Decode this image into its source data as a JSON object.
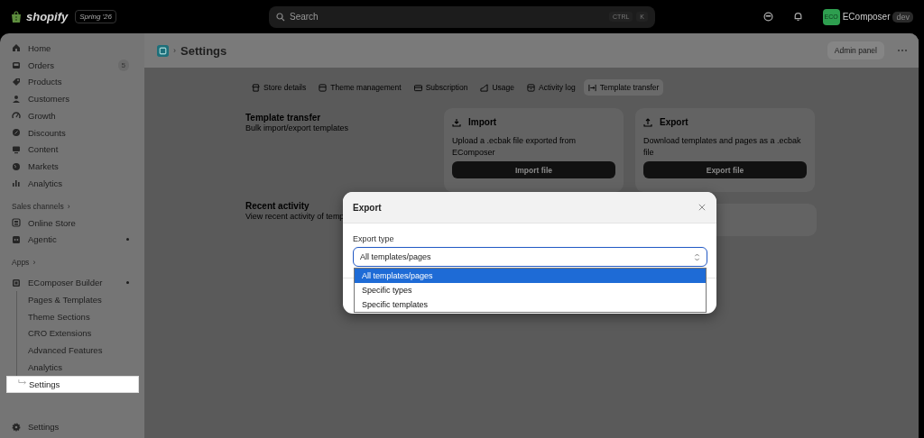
{
  "topbar": {
    "logo": "shopify",
    "version": "Spring '26",
    "search": {
      "placeholder": "Search"
    },
    "shortcut": [
      "CTRL",
      "K"
    ],
    "store": {
      "avatar": "ECO",
      "name": "EComposer",
      "tag": "dev"
    }
  },
  "sidebar": {
    "items": [
      {
        "kind": "item",
        "label": "Home",
        "selected": false
      },
      {
        "kind": "item",
        "label": "Orders",
        "badge": "5",
        "selected": false
      },
      {
        "kind": "item",
        "label": "Products",
        "selected": false
      },
      {
        "kind": "item",
        "label": "Customers",
        "selected": false
      },
      {
        "kind": "item",
        "label": "Growth",
        "selected": false
      },
      {
        "kind": "item",
        "label": "Discounts",
        "selected": false
      },
      {
        "kind": "item",
        "label": "Content",
        "selected": false
      },
      {
        "kind": "item",
        "label": "Markets",
        "selected": false
      },
      {
        "kind": "item",
        "label": "Analytics",
        "selected": false
      },
      {
        "kind": "section",
        "label": "Sales channels",
        "arrow": "›"
      },
      {
        "kind": "item",
        "label": "Online Store",
        "selected": false
      },
      {
        "kind": "item",
        "label": "Agentic",
        "dot": true,
        "selected": false
      },
      {
        "kind": "section",
        "label": "Apps",
        "arrow": "›"
      },
      {
        "kind": "app",
        "label": "EComposer Builder",
        "dot": true,
        "expanded": true,
        "selected": false,
        "children": [
          {
            "label": "Pages & Templates",
            "selected": false
          },
          {
            "label": "Theme Sections",
            "selected": false
          },
          {
            "label": "CRO Extensions",
            "selected": false
          },
          {
            "label": "Advanced Features",
            "selected": false
          },
          {
            "label": "Analytics",
            "selected": false
          },
          {
            "label": "Settings",
            "selected": true
          }
        ]
      }
    ],
    "footer": {
      "label": "Settings",
      "selected": false
    }
  },
  "page": {
    "separator": "›",
    "title": "Settings",
    "admin_button": "Admin panel",
    "tabs": [
      {
        "label": "Store details",
        "selected": false
      },
      {
        "label": "Theme management",
        "selected": false
      },
      {
        "label": "Subscription",
        "selected": false
      },
      {
        "label": "Usage",
        "selected": false
      },
      {
        "label": "Activity log",
        "selected": false
      },
      {
        "label": "Template transfer",
        "selected": true
      }
    ],
    "transfer": {
      "title": "Template transfer",
      "description": "Bulk import/export templates",
      "cards": [
        {
          "title": "Import",
          "description": "Upload a .ecbak file exported from EComposer",
          "button": "Import file"
        },
        {
          "title": "Export",
          "description": "Download templates and pages as a .ecbak file",
          "button": "Export file"
        }
      ]
    },
    "recent": {
      "title": "Recent activity",
      "description": "View recent activity of temp"
    }
  },
  "modal": {
    "title": "Export",
    "field_label": "Export type",
    "value": "All templates/pages",
    "options": [
      {
        "label": "All templates/pages",
        "selected": true
      },
      {
        "label": "Specific types",
        "selected": false
      },
      {
        "label": "Specific templates",
        "selected": false
      }
    ]
  }
}
